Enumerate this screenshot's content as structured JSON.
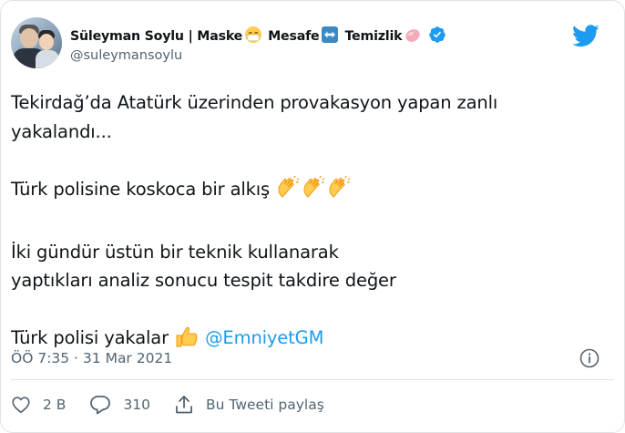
{
  "tweet": {
    "author": {
      "display_name": "Süleyman Soylu | Maske",
      "name_part_2": "Mesafe",
      "name_part_3": "Temizlik",
      "handle": "@suleymansoylu",
      "verified": true
    },
    "text": {
      "line1": "Tekirdağ’da Atatürk üzerinden provakasyon yapan  zanlı",
      "line2": "yakalandı...",
      "line3": "Türk polisine koskoca bir alkış",
      "line4": "İki gündür üstün bir teknik kullanarak",
      "line5": "yaptıkları analiz sonucu tespit takdire değer",
      "line6": "Türk polisi yakalar",
      "mention": "@EmniyetGM"
    },
    "timestamp": "ÖÖ 7:35 · 31 Mar 2021",
    "actions": {
      "like_count": "2 B",
      "reply_count": "310",
      "share_label": "Bu Tweeti paylaş"
    }
  },
  "icons": {
    "logo": "twitter-bird-icon",
    "verified": "verified-badge-icon",
    "info": "info-icon",
    "like": "heart-icon",
    "reply": "reply-icon",
    "share": "share-icon"
  },
  "colors": {
    "brand_blue": "#1d9bf0",
    "text_primary": "#0f1419",
    "text_secondary": "#536471",
    "border": "#dfe3e6"
  }
}
